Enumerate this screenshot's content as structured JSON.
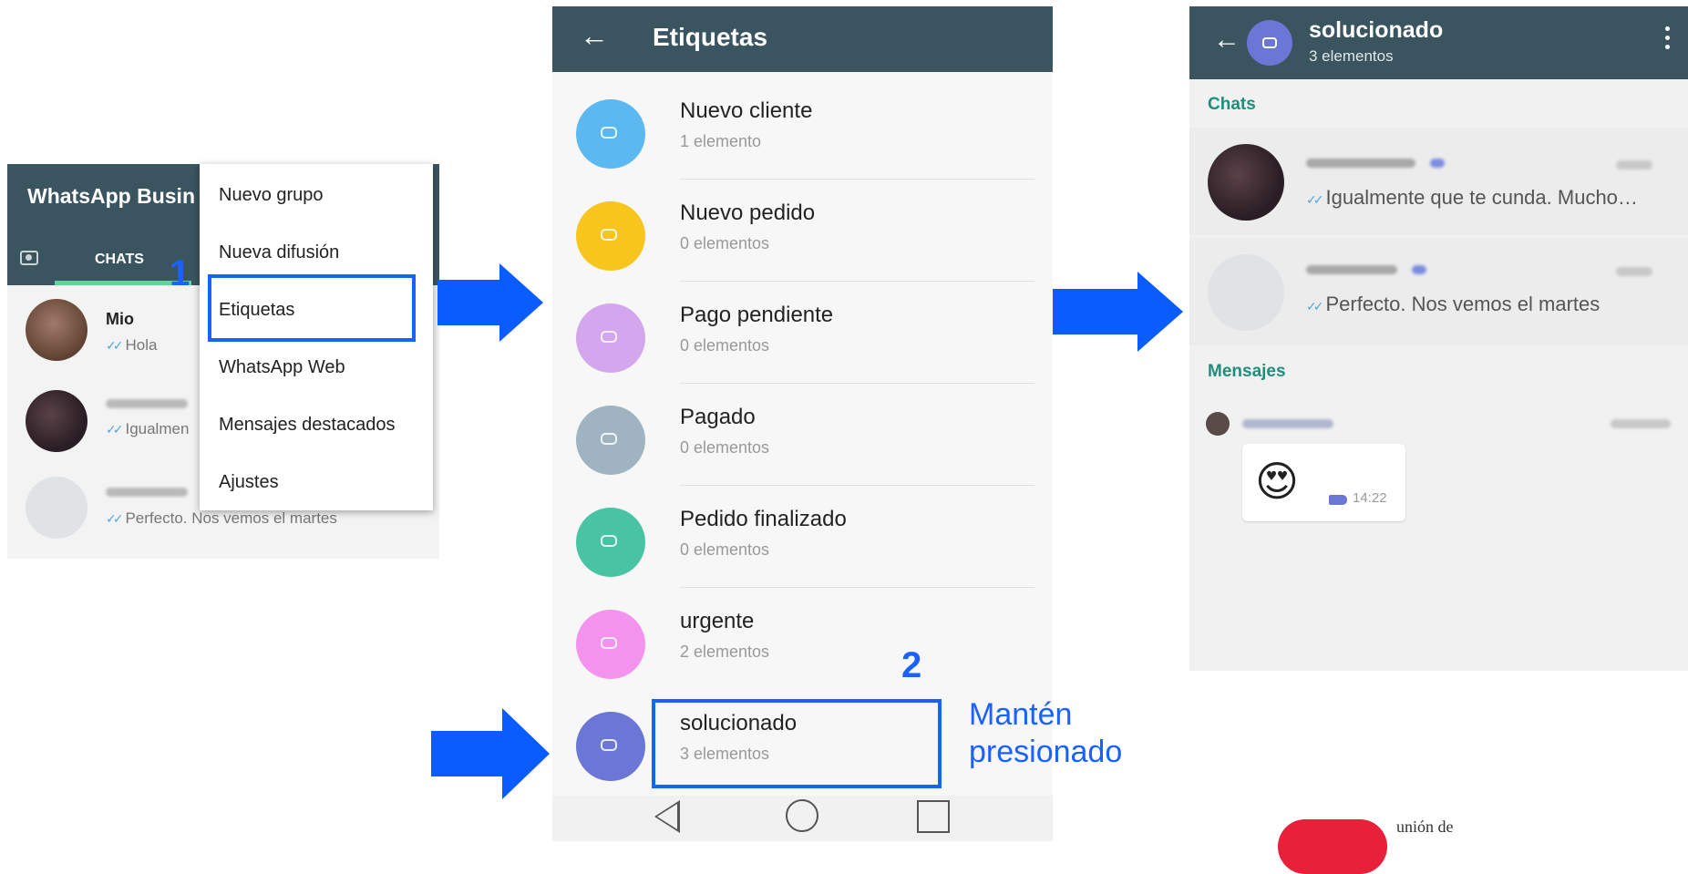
{
  "panel1": {
    "app_title": "WhatsApp Busin",
    "tab_label": "CHATS",
    "chats": [
      {
        "name": "Mio",
        "message": "Hola"
      },
      {
        "name": "",
        "message": "Igualmen"
      },
      {
        "name": "",
        "message": "Perfecto. Nos vemos el martes"
      }
    ],
    "menu_items": [
      "Nuevo grupo",
      "Nueva difusión",
      "Etiquetas",
      "WhatsApp Web",
      "Mensajes destacados",
      "Ajustes"
    ],
    "step_number": "1"
  },
  "panel2": {
    "title": "Etiquetas",
    "labels": [
      {
        "name": "Nuevo cliente",
        "count": "1 elemento",
        "color": "#5bb8f0"
      },
      {
        "name": "Nuevo pedido",
        "count": "0 elementos",
        "color": "#f7c51c"
      },
      {
        "name": "Pago pendiente",
        "count": "0 elementos",
        "color": "#d3a6ee"
      },
      {
        "name": "Pagado",
        "count": "0 elementos",
        "color": "#9fb3c0"
      },
      {
        "name": "Pedido finalizado",
        "count": "0 elementos",
        "color": "#48c4a4"
      },
      {
        "name": "urgente",
        "count": "2 elementos",
        "color": "#f493ee"
      },
      {
        "name": "solucionado",
        "count": "3 elementos",
        "color": "#6b77d6"
      }
    ],
    "step_number": "2",
    "instruction_line1": "Mantén",
    "instruction_line2": "presionado"
  },
  "panel3": {
    "title": "solucionado",
    "subtitle": "3 elementos",
    "section_chats": "Chats",
    "chats": [
      {
        "message": "Igualmente que te cunda. Mucho…"
      },
      {
        "message": "Perfecto. Nos vemos el martes"
      }
    ],
    "section_messages": "Mensajes",
    "message_time": "14:22"
  },
  "footer": {
    "logo_text": "unión de"
  },
  "colors": {
    "header": "#3b5560",
    "accent_blue": "#1a62ff",
    "arrow_blue": "#0a5cff",
    "section_green": "#1e8f7c"
  }
}
